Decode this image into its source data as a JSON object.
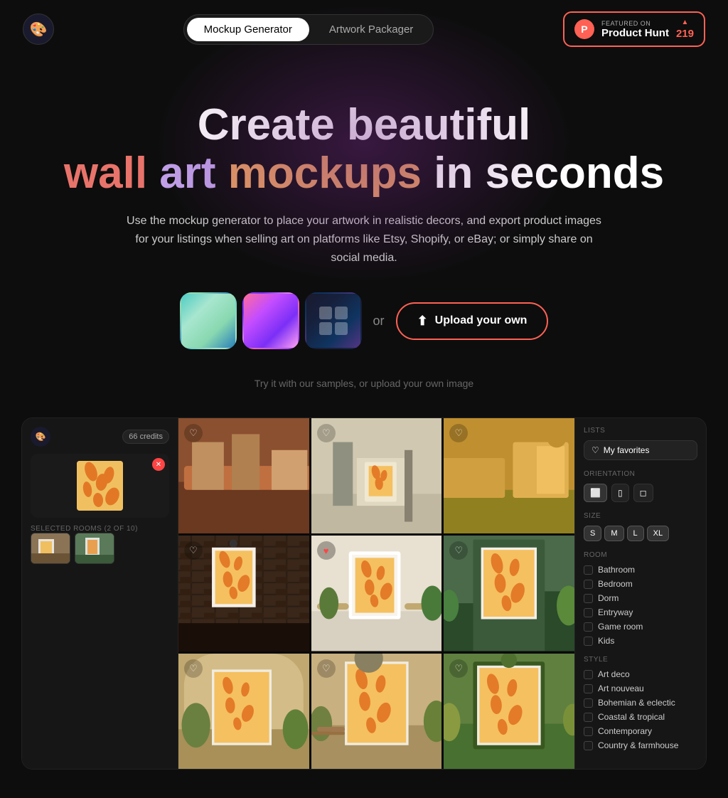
{
  "nav": {
    "tab_mockup": "Mockup Generator",
    "tab_artwork": "Artwork Packager"
  },
  "producthunt": {
    "featured_label": "FEATURED ON",
    "name": "Product Hunt",
    "count": "219"
  },
  "hero": {
    "title_line1": "Create beautiful",
    "word_wall": "wall",
    "word_art": "art",
    "word_mockups": "mockups",
    "word_inseconds": "in seconds",
    "subtitle": "Use the mockup generator to place your artwork in realistic decors, and export product images for your listings when selling art on platforms like Etsy, Shopify, or eBay; or simply share on social media.",
    "upload_btn": "Upload your own",
    "samples_hint": "Try it with our samples, or upload your own image"
  },
  "left_panel": {
    "credits": "66 credits",
    "selected_rooms_label": "SELECTED ROOMS (2 OF 10)"
  },
  "right_panel": {
    "lists_label": "LISTS",
    "favorites_label": "My favorites",
    "orientation_label": "ORIENTATION",
    "size_label": "SIZE",
    "sizes": [
      "S",
      "M",
      "L",
      "XL"
    ],
    "room_label": "ROOM",
    "rooms": [
      "Bathroom",
      "Bedroom",
      "Dorm",
      "Entryway",
      "Game room",
      "Kids"
    ],
    "style_label": "STYLE",
    "styles": [
      "Art deco",
      "Art nouveau",
      "Bohemian & eclectic",
      "Coastal & tropical",
      "Contemporary",
      "Country & farmhouse"
    ]
  }
}
